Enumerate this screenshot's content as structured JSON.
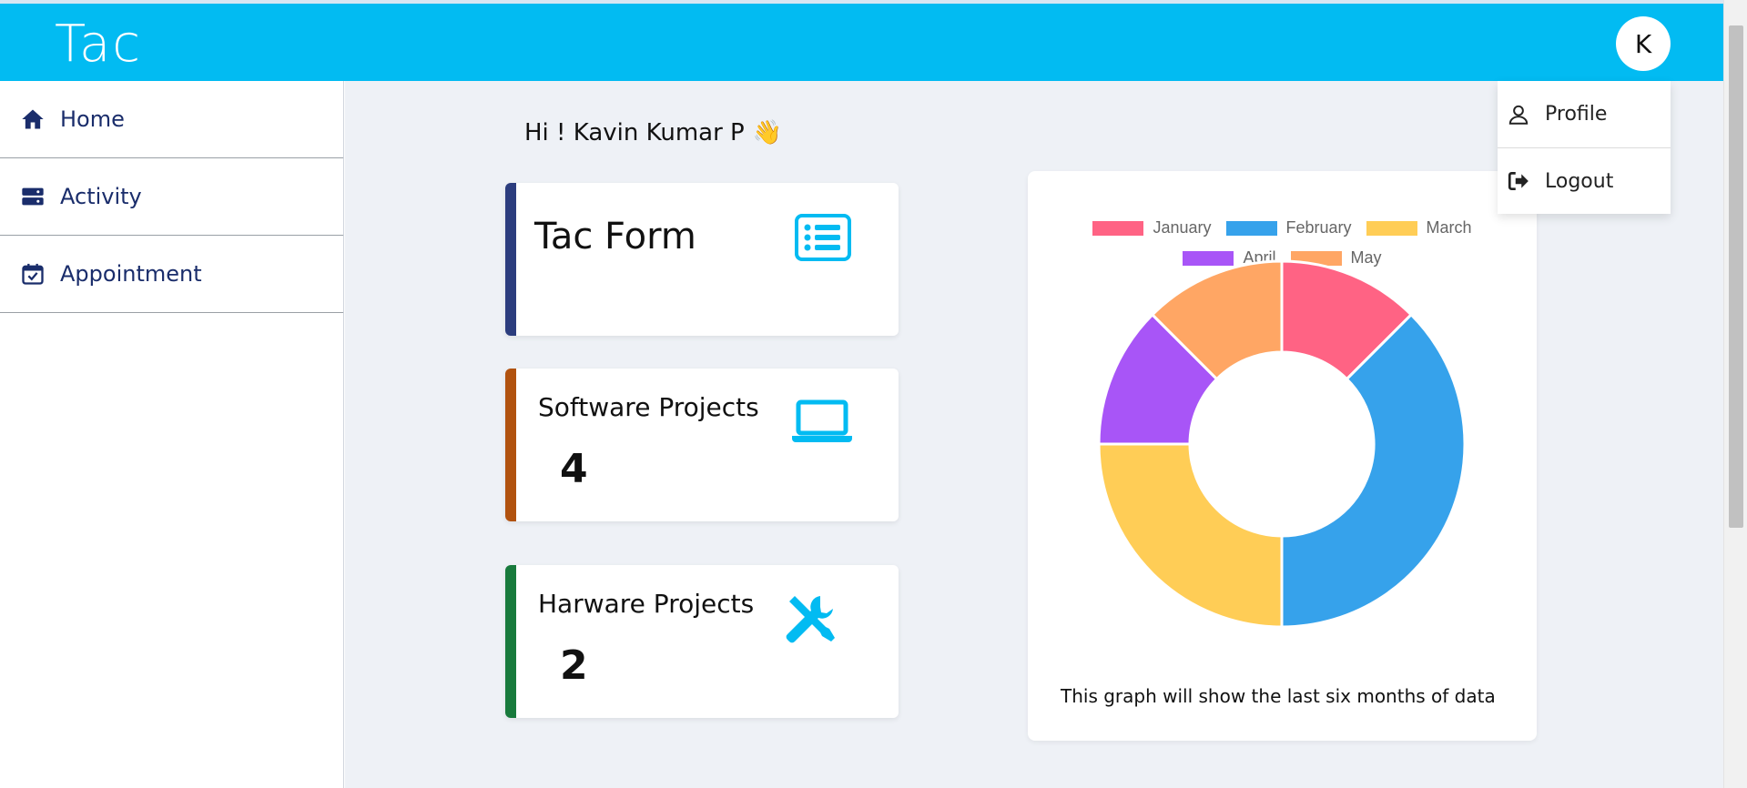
{
  "header": {
    "logo": "Tac",
    "avatar_initial": "K",
    "color": "#02bbf2"
  },
  "sidebar": {
    "items": [
      {
        "label": "Home",
        "icon": "home-icon"
      },
      {
        "label": "Activity",
        "icon": "server-icon"
      },
      {
        "label": "Appointment",
        "icon": "calendar-check-icon"
      }
    ]
  },
  "greeting": {
    "text": "Hi ! Kavin Kumar P",
    "emoji": "👋"
  },
  "cards": [
    {
      "title": "Tac Form",
      "icon": "list-icon",
      "accent": "#2c3d7e"
    },
    {
      "title": "Software Projects",
      "count": "4",
      "icon": "laptop-icon",
      "accent": "#b1520f"
    },
    {
      "title": "Harware Projects",
      "count": "2",
      "icon": "tools-icon",
      "accent": "#187a3c"
    }
  ],
  "chart": {
    "caption": "This graph will show the last six months of data"
  },
  "chart_data": {
    "type": "pie",
    "variant": "doughnut",
    "labels": [
      "January",
      "February",
      "March",
      "April",
      "May"
    ],
    "values": [
      1,
      3,
      2,
      1,
      1
    ],
    "colors": [
      "#ff6384",
      "#36a2eb",
      "#ffcd56",
      "#a855f7",
      "#ffa664"
    ],
    "legend": "top",
    "caption": "This graph will show the last six months of data"
  },
  "dropdown": {
    "items": [
      {
        "label": "Profile",
        "icon": "user-icon"
      },
      {
        "label": "Logout",
        "icon": "logout-icon"
      }
    ]
  }
}
